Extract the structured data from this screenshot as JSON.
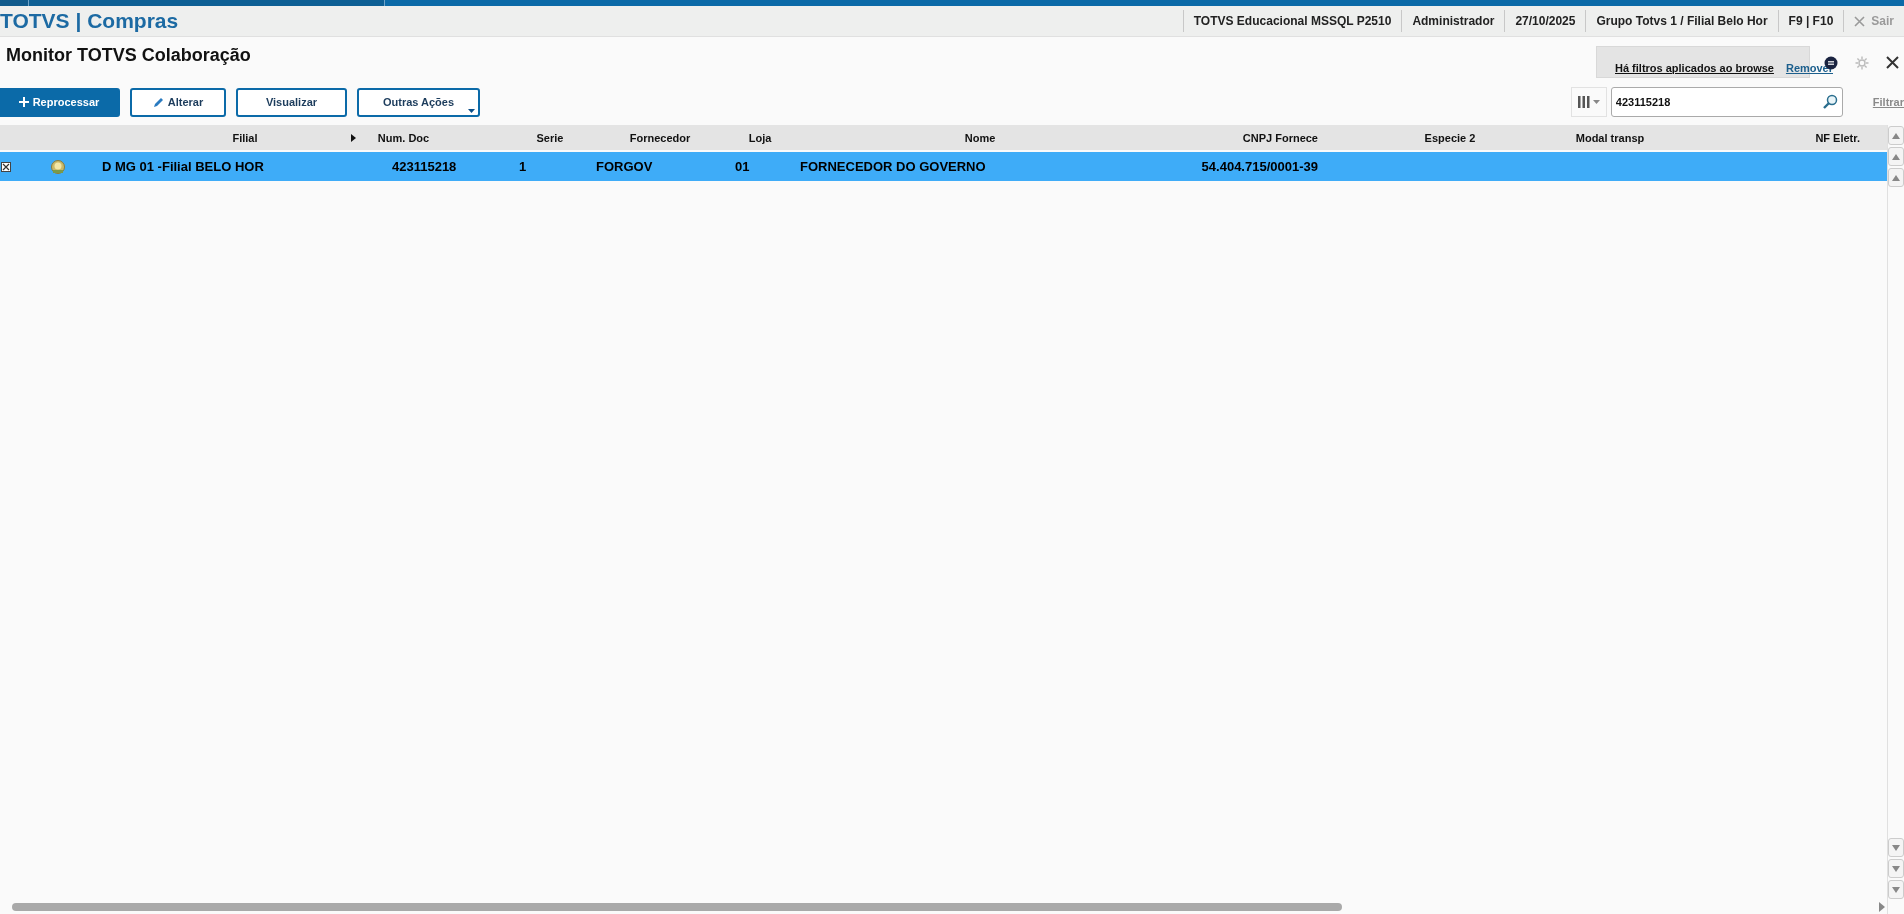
{
  "app": {
    "title": "TOTVS | Compras"
  },
  "header_items": [
    {
      "label": "TOTVS Educacional MSSQL P2510",
      "disabled": false
    },
    {
      "label": "Administrador",
      "disabled": false
    },
    {
      "label": "27/10/2025",
      "disabled": false
    },
    {
      "label": "Grupo Totvs 1 / Filial Belo Hor",
      "disabled": false
    },
    {
      "label": "F9 | F10",
      "disabled": false
    },
    {
      "label": "Sair",
      "disabled": true
    }
  ],
  "page": {
    "title": "Monitor TOTVS Colaboração"
  },
  "filter_notice": {
    "text": "Há filtros aplicados ao browse",
    "action": "Remover"
  },
  "actions": [
    {
      "label": "Reprocessar",
      "kind": "primary"
    },
    {
      "label": "Alterar",
      "kind": "edit"
    },
    {
      "label": "Visualizar",
      "kind": "plain"
    },
    {
      "label": "Outras Ações",
      "kind": "menu"
    }
  ],
  "search": {
    "value": "423115218",
    "link": "Filtrar"
  },
  "table": {
    "columns": [
      "Filial",
      "Num. Doc",
      "Serie",
      "Fornecedor",
      "Loja",
      "Nome",
      "CNPJ Fornece",
      "Especie 2",
      "Modal transp",
      "NF Eletr."
    ],
    "rows": [
      {
        "selected": true,
        "cells": [
          "D MG 01 -Filial BELO HOR",
          "423115218",
          "1",
          "FORGOV",
          "01",
          "FORNECEDOR DO GOVERNO",
          "54.404.715/0001-39",
          "",
          "",
          ""
        ]
      }
    ]
  }
}
